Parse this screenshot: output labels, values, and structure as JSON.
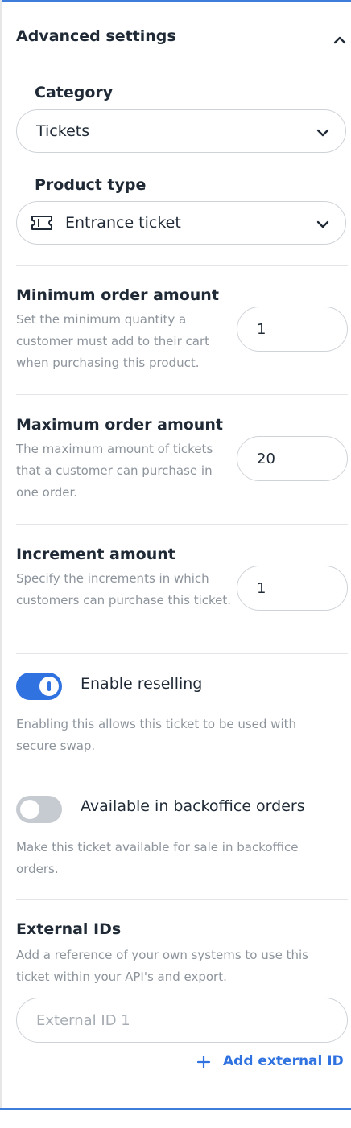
{
  "header": {
    "title": "Advanced settings"
  },
  "category": {
    "label": "Category",
    "value": "Tickets"
  },
  "product_type": {
    "label": "Product type",
    "value": "Entrance ticket"
  },
  "minimum_order": {
    "title": "Minimum order amount",
    "description": "Set the minimum quantity a customer must add to their cart when purchasing this product.",
    "value": "1"
  },
  "maximum_order": {
    "title": "Maximum order amount",
    "description": "The maximum amount of tickets that a customer can purchase in one order.",
    "value": "20"
  },
  "increment": {
    "title": "Increment amount",
    "description": "Specify the increments in which customers can purchase this ticket.",
    "value": "1"
  },
  "reselling": {
    "label": "Enable reselling",
    "enabled": true,
    "description": "Enabling this allows this ticket to be used with secure swap."
  },
  "backoffice": {
    "label": "Available in backoffice orders",
    "enabled": false,
    "description": "Make this ticket available for sale in backoffice orders."
  },
  "external_ids": {
    "title": "External IDs",
    "description": "Add a reference of your own systems to use this ticket within your API's and export.",
    "placeholder": "External ID 1",
    "add_label": "Add external ID"
  },
  "colors": {
    "accent": "#2f72e0",
    "border": "#cfd3d8",
    "muted_text": "#8d949c",
    "toggle_off": "#c6cbd1"
  }
}
